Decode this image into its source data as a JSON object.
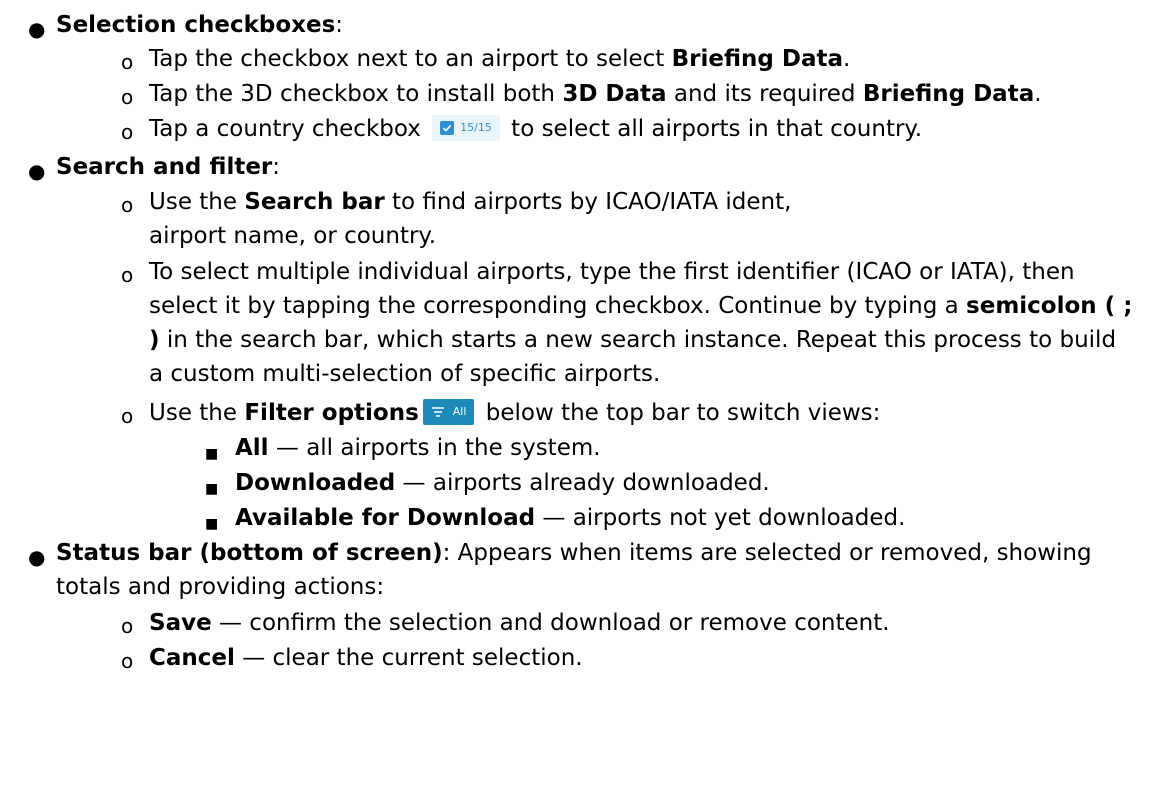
{
  "sections": {
    "selection": {
      "title": "Selection checkboxes",
      "punct": ":",
      "item1": {
        "pre": "Tap the checkbox next to an airport to select ",
        "bold": "Briefing Data",
        "post": "."
      },
      "item2": {
        "pre": "Tap the 3D checkbox to install both ",
        "bold1": "3D Data",
        "mid": " and its required ",
        "bold2": "Briefing Data",
        "post": "."
      },
      "item3": {
        "pre": "Tap a country checkbox ",
        "chip_count": "15/15",
        "post": " to select all airports in that country."
      }
    },
    "search": {
      "title": "Search and filter",
      "punct": ":",
      "item1": {
        "pre": "Use the ",
        "bold": "Search bar",
        "post": " to find airports by ICAO/IATA ident, airport name, or country."
      },
      "item2": {
        "pre": "To select multiple individual airports, type the first identifier (ICAO or IATA), then select it by tapping the corresponding checkbox. Continue by typing a ",
        "bold": "semicolon ( ; )",
        "post": " in the search bar, which starts a new search instance. Repeat this process to build a custom multi-selection of specific airports."
      },
      "item3": {
        "pre": "Use the ",
        "bold": "Filter options",
        "chip_label": "All",
        "post": " below the top bar to switch views:"
      },
      "views": [
        {
          "bold": "All",
          "rest": " — all airports in the system."
        },
        {
          "bold": "Downloaded",
          "rest": " — airports already downloaded."
        },
        {
          "bold": "Available for Download",
          "rest": " — airports not yet downloaded."
        }
      ]
    },
    "status": {
      "title": "Status bar (bottom of screen)",
      "text": ": Appears when items are selected or removed, showing totals and providing actions:",
      "items": [
        {
          "bold": "Save",
          "rest": " — confirm the selection and download or remove content."
        },
        {
          "bold": "Cancel",
          "rest": " — clear the current selection."
        }
      ]
    }
  },
  "icons": {
    "check": "checkmark-icon",
    "filter": "filter-lines-icon"
  },
  "colors": {
    "chip_check": "#2f8fd3",
    "chip_bg": "#eaf4fb",
    "filter_bg": "#1b8ab8"
  }
}
